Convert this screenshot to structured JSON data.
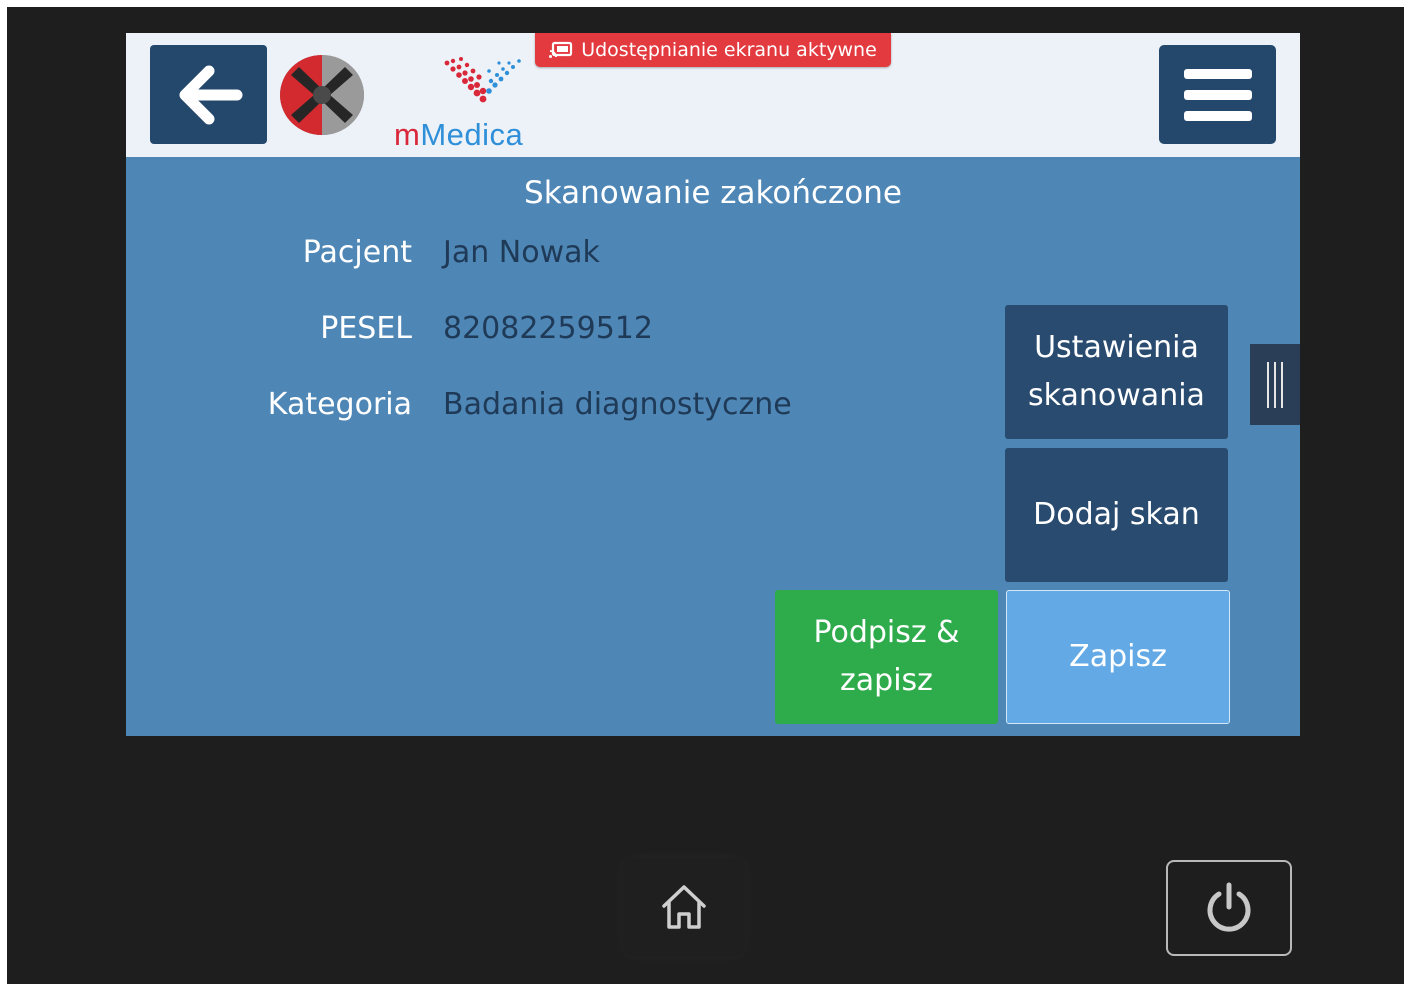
{
  "header": {
    "share_banner": "Udostępnianie ekranu aktywne",
    "brand_logo": {
      "part1": "m",
      "part2": "Medica"
    },
    "icons": {
      "back": "arrow-left-icon",
      "menu": "hamburger-menu-icon",
      "cast": "screen-share-icon"
    }
  },
  "main": {
    "title": "Skanowanie zakończone",
    "fields": [
      {
        "label": "Pacjent",
        "value": "Jan Nowak"
      },
      {
        "label": "PESEL",
        "value": "82082259512"
      },
      {
        "label": "Kategoria",
        "value": "Badania diagnostyczne"
      }
    ],
    "buttons": {
      "scan_settings_line1": "Ustawienia",
      "scan_settings_line2": "skanowania",
      "add_scan": "Dodaj skan",
      "sign_save_line1": "Podpisz &",
      "sign_save_line2": "zapisz",
      "save": "Zapisz"
    }
  },
  "device": {
    "icons": {
      "home": "home-icon",
      "power": "power-icon",
      "side": "drawer-handle-icon"
    }
  },
  "colors": {
    "screen_bg": "#4e86b6",
    "header_bg": "#edf2f8",
    "dark_button": "#294b6f",
    "green_button": "#2eab4b",
    "light_button": "#62a9e6",
    "banner": "#e23a3f",
    "brand_red": "#d8283a",
    "brand_blue": "#2f8fd8"
  }
}
